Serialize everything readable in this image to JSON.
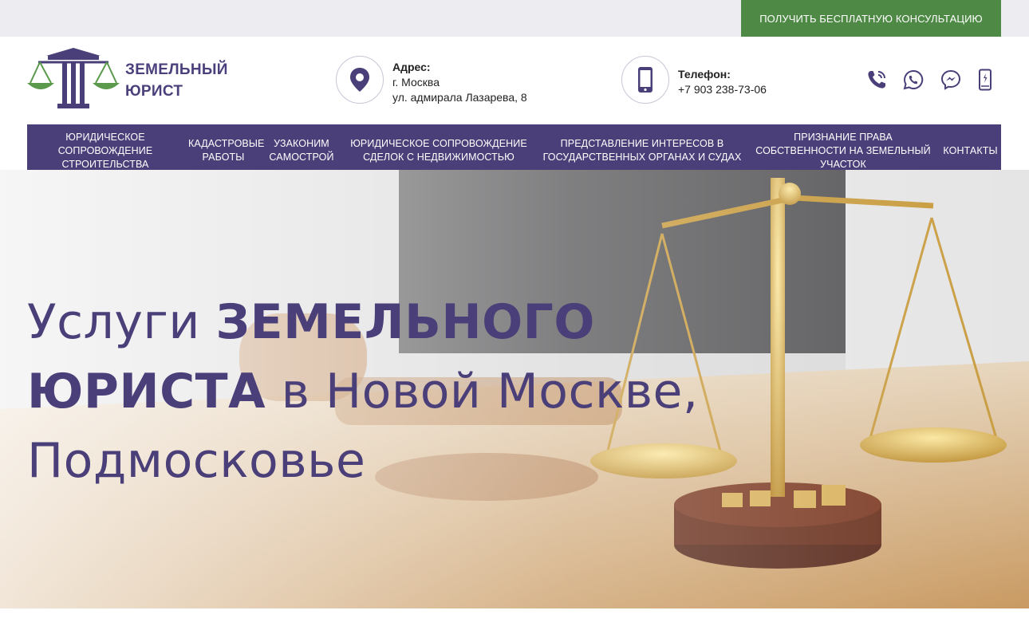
{
  "topbar": {
    "cta_label": "ПОЛУЧИТЬ БЕСПЛАТНУЮ КОНСУЛЬТАЦИЮ"
  },
  "logo": {
    "line1": "ЗЕМЕЛЬНЫЙ",
    "line2": "ЮРИСТ",
    "icon": "scales-logo-icon"
  },
  "address": {
    "label": "Адрес:",
    "city": "г. Москва",
    "street": "ул. адмирала Лазарева, 8",
    "icon": "map-pin-icon"
  },
  "phone": {
    "label": "Телефон:",
    "number": "+7 903 238-73-06",
    "icon": "smartphone-icon"
  },
  "socials": [
    {
      "icon": "phone-call-icon"
    },
    {
      "icon": "whatsapp-icon"
    },
    {
      "icon": "messenger-icon"
    },
    {
      "icon": "mobile-phone-icon"
    }
  ],
  "nav": {
    "items": [
      {
        "label": "ЮРИДИЧЕСКОЕ СОПРОВОЖДЕНИЕ СТРОИТЕЛЬСТВА"
      },
      {
        "label": "КАДАСТРОВЫЕ РАБОТЫ"
      },
      {
        "label": "УЗАКОНИМ САМОСТРОЙ"
      },
      {
        "label": "ЮРИДИЧЕСКОЕ СОПРОВОЖДЕНИЕ СДЕЛОК С НЕДВИЖИМОСТЬЮ"
      },
      {
        "label": "ПРЕДСТАВЛЕНИЕ ИНТЕРЕСОВ В ГОСУДАРСТВЕННЫХ ОРГАНАХ И СУДАХ"
      },
      {
        "label": "ПРИЗНАНИЕ ПРАВА СОБСТВЕННОСТИ НА ЗЕМЕЛЬНЫЙ УЧАСТОК"
      },
      {
        "label": "КОНТАКТЫ"
      }
    ]
  },
  "hero": {
    "title_part1": "Услуги ",
    "title_bold1": "ЗЕМЕЛЬНОГО",
    "title_bold2": "ЮРИСТА",
    "title_part2": " в Новой Москве,",
    "title_part3": "Подмосковье"
  },
  "colors": {
    "brand_purple": "#4a3f78",
    "cta_green": "#4e8a45",
    "topbar_gray": "#ececf1"
  }
}
